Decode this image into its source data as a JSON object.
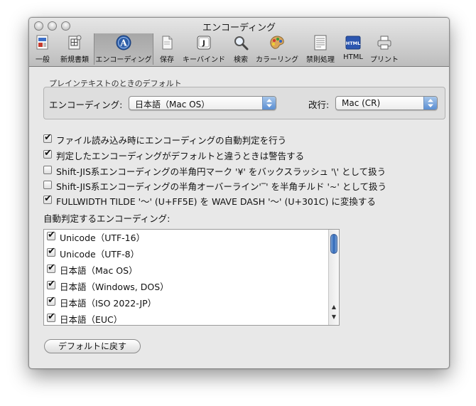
{
  "window": {
    "title": "エンコーディング"
  },
  "toolbar": {
    "items": [
      {
        "label": "一般",
        "icon": "general-prefs-icon"
      },
      {
        "label": "新規書類",
        "icon": "new-document-icon"
      },
      {
        "label": "エンコーディング",
        "icon": "encoding-icon",
        "selected": true
      },
      {
        "label": "保存",
        "icon": "save-icon"
      },
      {
        "label": "キーバインド",
        "icon": "keybinding-icon"
      },
      {
        "label": "検索",
        "icon": "search-icon"
      },
      {
        "label": "カラーリング",
        "icon": "coloring-palette-icon"
      },
      {
        "label": "禁則処理",
        "icon": "line-break-rules-icon"
      },
      {
        "label": "HTML",
        "icon": "html-icon"
      },
      {
        "label": "プリント",
        "icon": "printer-icon"
      }
    ]
  },
  "plain_text_defaults": {
    "group_title": "プレインテキストのときのデフォルト",
    "encoding_label": "エンコーディング:",
    "encoding_value": "日本語（Mac OS）",
    "linebreak_label": "改行:",
    "linebreak_value": "Mac (CR)"
  },
  "options": [
    {
      "label": "ファイル読み込み時にエンコーディングの自動判定を行う",
      "checked": true
    },
    {
      "label": "判定したエンコーディングがデフォルトと違うときは警告する",
      "checked": true
    },
    {
      "label": "Shift-JIS系エンコーディングの半角円マーク '¥' をバックスラッシュ '\\' として扱う",
      "checked": false
    },
    {
      "label": "Shift-JIS系エンコーディングの半角オーバーライン'‾' を半角チルド '~' として扱う",
      "checked": false
    },
    {
      "label": "FULLWIDTH TILDE '～' (U+FF5E) を WAVE DASH '〜' (U+301C) に変換する",
      "checked": true
    }
  ],
  "auto_detect": {
    "title": "自動判定するエンコーディング:",
    "items": [
      {
        "label": "Unicode（UTF-16）",
        "checked": true
      },
      {
        "label": "Unicode（UTF-8）",
        "checked": true
      },
      {
        "label": "日本語（Mac OS）",
        "checked": true
      },
      {
        "label": "日本語（Windows, DOS）",
        "checked": true
      },
      {
        "label": "日本語（ISO 2022-JP）",
        "checked": true
      },
      {
        "label": "日本語（EUC）",
        "checked": true
      }
    ],
    "scroll_up_icon": "scroll-up-arrow-icon",
    "scroll_down_icon": "scroll-down-arrow-icon"
  },
  "buttons": {
    "restore_defaults": "デフォルトに戻す"
  },
  "colors": {
    "popup_arrow_blue": "#5a8ed3",
    "scroll_thumb_blue": "#2d66b8"
  }
}
